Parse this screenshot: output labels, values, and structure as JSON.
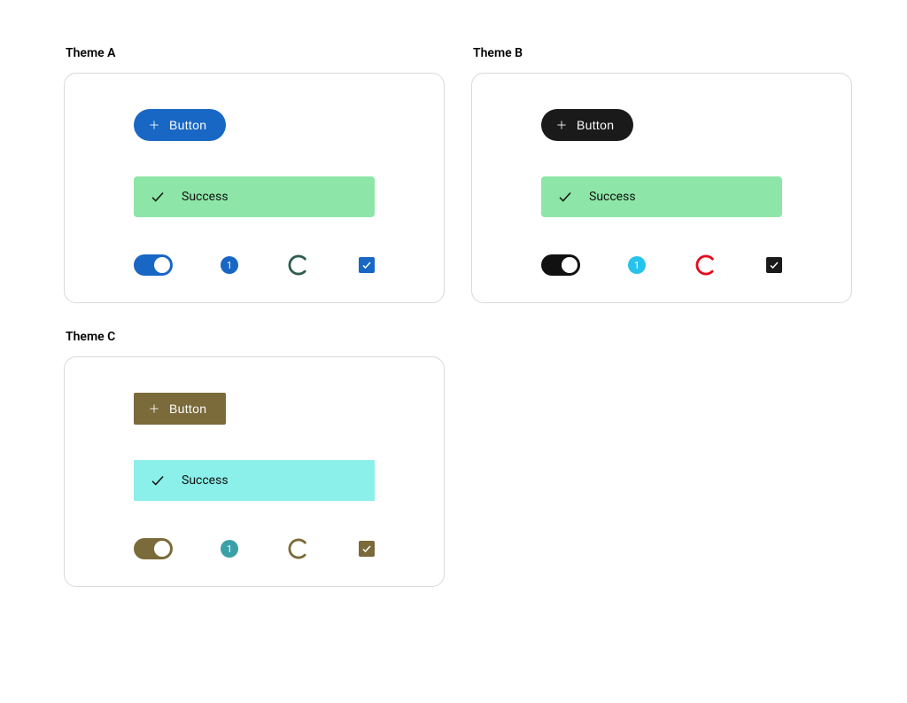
{
  "themes": {
    "a": {
      "title": "Theme A",
      "button_label": "Button",
      "alert_text": "Success",
      "badge_value": "1",
      "colors": {
        "button_bg": "#1867c5",
        "alert_bg": "#8de6a7",
        "toggle_bg": "#1867c5",
        "badge_bg": "#1867c5",
        "spinner": "#2f5d4e",
        "checkbox_bg": "#1867c5"
      }
    },
    "b": {
      "title": "Theme B",
      "button_label": "Button",
      "alert_text": "Success",
      "badge_value": "1",
      "colors": {
        "button_bg": "#1a1a1a",
        "alert_bg": "#8de6a7",
        "toggle_bg": "#111111",
        "badge_bg": "#26c3eb",
        "spinner": "#e40b1c",
        "checkbox_bg": "#1a1a1a"
      }
    },
    "c": {
      "title": "Theme C",
      "button_label": "Button",
      "alert_text": "Success",
      "badge_value": "1",
      "colors": {
        "button_bg": "#7b6a3a",
        "alert_bg": "#8af0e9",
        "toggle_bg": "#7b6a3a",
        "badge_bg": "#3aa0a8",
        "spinner": "#7b6a3a",
        "checkbox_bg": "#7b6a3a"
      }
    }
  }
}
